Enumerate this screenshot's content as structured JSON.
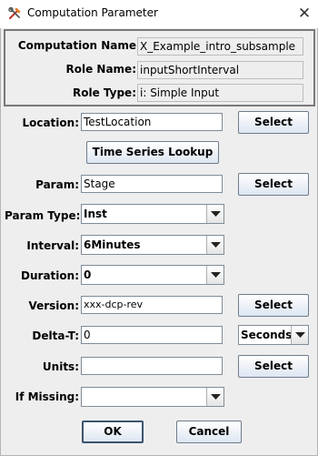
{
  "window": {
    "title": "Computation Parameter",
    "close_glyph": "✕"
  },
  "info": {
    "computation_name_label": "Computation Name",
    "computation_name_value": "X_Example_intro_subsample",
    "role_name_label": "Role Name:",
    "role_name_value": "inputShortInterval",
    "role_type_label": "Role Type:",
    "role_type_value": "i: Simple Input"
  },
  "form": {
    "location_label": "Location:",
    "location_value": "TestLocation",
    "location_select": "Select",
    "ts_lookup_button": "Time Series Lookup",
    "param_label": "Param:",
    "param_value": "Stage",
    "param_select": "Select",
    "param_type_label": "Param Type:",
    "param_type_value": "Inst",
    "interval_label": "Interval:",
    "interval_value": "6Minutes",
    "duration_label": "Duration:",
    "duration_value": "0",
    "version_label": "Version:",
    "version_value": "xxx-dcp-rev",
    "version_select": "Select",
    "delta_t_label": "Delta-T:",
    "delta_t_value": "0",
    "delta_t_units": "Seconds",
    "units_label": "Units:",
    "units_value": "",
    "units_select": "Select",
    "if_missing_label": "If Missing:",
    "if_missing_value": ""
  },
  "footer": {
    "ok": "OK",
    "cancel": "Cancel"
  },
  "icons": {
    "app": "tools-icon",
    "close": "close-icon",
    "dropdown": "chevron-down-icon"
  }
}
